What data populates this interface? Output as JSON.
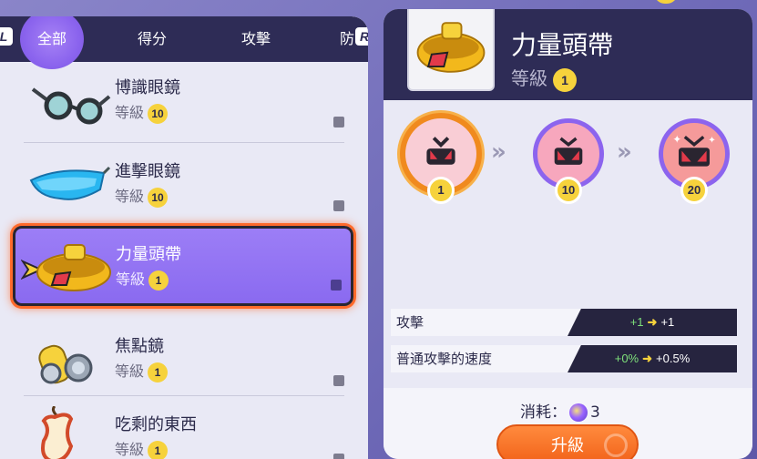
{
  "tabs": {
    "left_button": "L",
    "right_button": "R",
    "items": [
      {
        "label": "全部",
        "active": true
      },
      {
        "label": "得分",
        "active": false
      },
      {
        "label": "攻擊",
        "active": false
      },
      {
        "label": "防",
        "active": false
      }
    ]
  },
  "items": [
    {
      "name": "博識眼鏡",
      "level_label": "等級",
      "level": "10",
      "icon": "glasses-icon"
    },
    {
      "name": "進擊眼鏡",
      "level_label": "等級",
      "level": "10",
      "icon": "goggles-icon"
    },
    {
      "name": "力量頭帶",
      "level_label": "等級",
      "level": "1",
      "icon": "headband-icon",
      "selected": true
    },
    {
      "name": "焦點鏡",
      "level_label": "等級",
      "level": "1",
      "icon": "scope-lens-icon"
    },
    {
      "name": "吃剩的東西",
      "level_label": "等級",
      "level": "1",
      "icon": "leftovers-icon"
    }
  ],
  "detail": {
    "name": "力量頭帶",
    "level_label": "等級",
    "level": "1",
    "stages": [
      "1",
      "10",
      "20"
    ],
    "stats": [
      {
        "name": "攻擊",
        "from": "+1",
        "to": "+1"
      },
      {
        "name": "普通攻擊的速度",
        "from": "+0%",
        "to": "+0.5%"
      }
    ],
    "cost_label": "消耗：",
    "cost_value": "3",
    "upgrade_label": "升級"
  },
  "colors": {
    "accent_orange": "#f2631a",
    "selected_purple": "#8a6af0",
    "header_navy": "#2e2c56",
    "badge_yellow": "#f6d23c"
  }
}
